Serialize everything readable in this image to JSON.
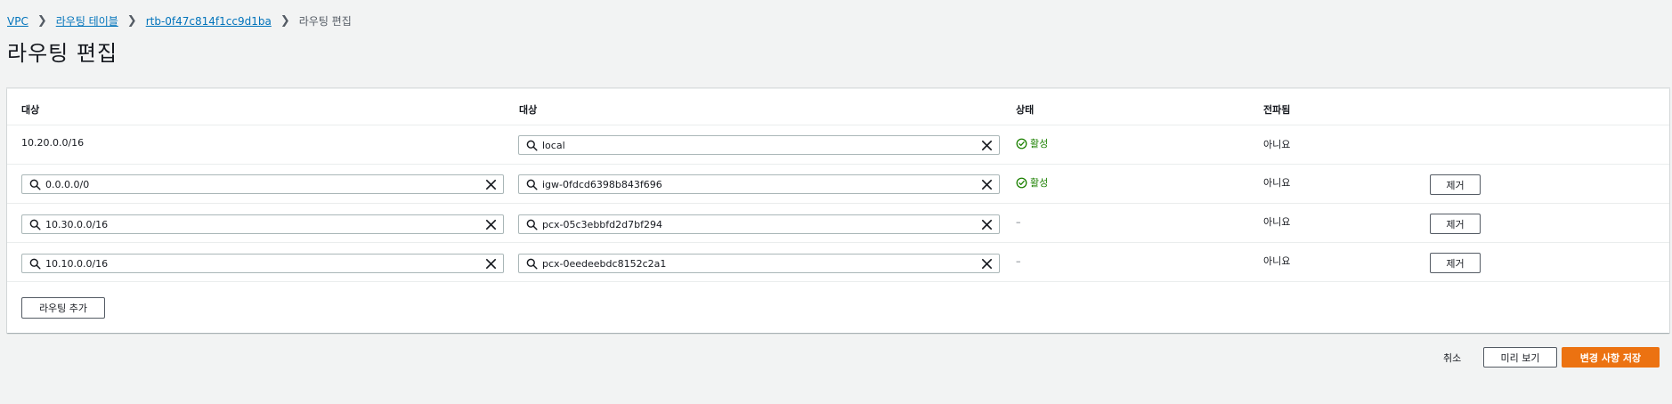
{
  "breadcrumb": {
    "items": [
      "VPC",
      "라우팅 테이블",
      "rtb-0f47c814f1cc9d1ba"
    ],
    "current": "라우팅 편집"
  },
  "page_title": "라우팅 편집",
  "table": {
    "headers": {
      "destination": "대상",
      "target": "대상",
      "status": "상태",
      "propagated": "전파됨"
    },
    "rows": [
      {
        "destination": "10.20.0.0/16",
        "target": "local",
        "status": "활성",
        "propagated": "아니요"
      },
      {
        "destination": "0.0.0.0/0",
        "target": "igw-0fdcd6398b843f696",
        "status": "활성",
        "propagated": "아니요",
        "remove_label": "제거"
      },
      {
        "destination": "10.30.0.0/16",
        "target": "pcx-05c3ebbfd2d7bf294",
        "status": "–",
        "propagated": "아니요",
        "remove_label": "제거"
      },
      {
        "destination": "10.10.0.0/16",
        "target": "pcx-0eedeebdc8152c2a1",
        "status": "–",
        "propagated": "아니요",
        "remove_label": "제거"
      }
    ]
  },
  "add_route_label": "라우팅 추가",
  "footer": {
    "cancel_label": "취소",
    "preview_label": "미리 보기",
    "save_label": "변경 사항 저장"
  },
  "colors": {
    "link": "#0073bb",
    "status_active": "#1d8102",
    "primary": "#ec7211"
  },
  "icons": {
    "breadcrumb_separator": "chevron-right-icon",
    "field_search": "search-icon",
    "field_clear": "close-icon",
    "status_active": "status-check-icon"
  }
}
